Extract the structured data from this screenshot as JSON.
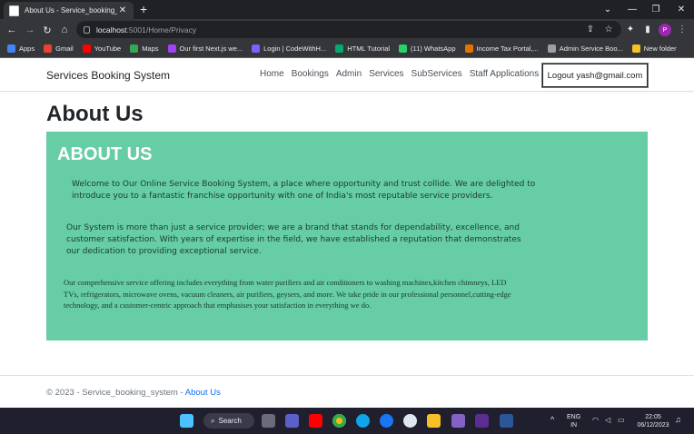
{
  "browser": {
    "tab_title": "About Us - Service_booking_sys",
    "url_host": "localhost",
    "url_path": ":5001/Home/Privacy",
    "profile_initial": "P",
    "bookmarks": [
      {
        "label": "Apps",
        "color": "#4285f4"
      },
      {
        "label": "Gmail",
        "color": "#ea4335"
      },
      {
        "label": "YouTube",
        "color": "#ff0000"
      },
      {
        "label": "Maps",
        "color": "#34a853"
      },
      {
        "label": "Our first Next.js we...",
        "color": "#a142f4"
      },
      {
        "label": "Login | CodeWithH...",
        "color": "#7b61ff"
      },
      {
        "label": "HTML Tutorial",
        "color": "#04aa6d"
      },
      {
        "label": "(11) WhatsApp",
        "color": "#25d366"
      },
      {
        "label": "Income Tax Portal,...",
        "color": "#e37400"
      },
      {
        "label": "Admin Service Boo...",
        "color": "#9aa0a6"
      },
      {
        "label": "New folder",
        "color": "#f6c026"
      }
    ]
  },
  "navbar": {
    "brand": "Services Booking System",
    "links": [
      "Home",
      "Bookings",
      "Admin",
      "Services",
      "SubServices",
      "Staff Applications"
    ],
    "logout_label": "Logout yash@gmail.com"
  },
  "main": {
    "heading": "About Us",
    "panel_title": "ABOUT US",
    "paragraph1": "Welcome to Our Online Service Booking System, a place where opportunity and trust collide. We are delighted to introduce you to a fantastic franchise opportunity with one of India's most reputable service providers.",
    "paragraph2": "Our System is more than just a service provider; we are a brand that stands for dependability, excellence, and customer satisfaction. With years of expertise in the field, we have established a reputation that demonstrates our dedication to providing exceptional service.",
    "paragraph3": "Our comprehensive service offering includes everything from water purifiers and air conditioners to washing machines,kitchen chimneys, LED TVs, refrigerators, microwave ovens, vacuum cleaners, air purifiers, geysers, and more. We take pride in our professional personnel,cutting-edge technology, and a customer-centric approach that emphasises your satisfaction in everything we do.",
    "panel_color": "#66cda4"
  },
  "footer": {
    "copyright": "© 2023 - Service_booking_system - ",
    "link": "About Us"
  },
  "taskbar": {
    "search_label": "Search",
    "lang_line1": "ENG",
    "lang_line2": "IN",
    "time": "22:05",
    "date": "06/12/2023"
  }
}
